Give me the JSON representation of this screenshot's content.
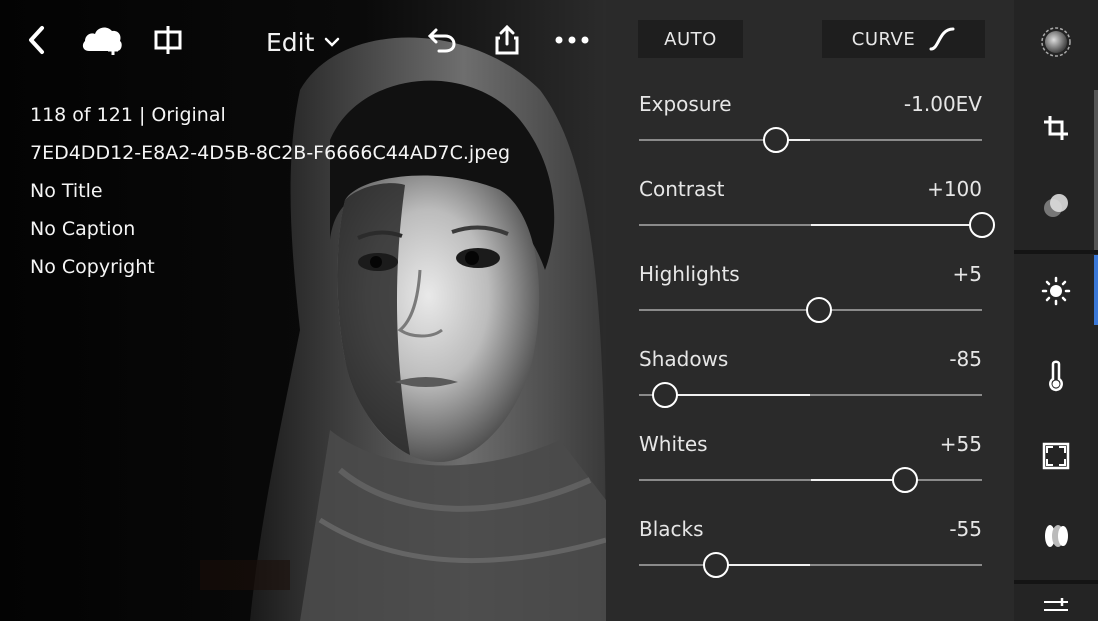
{
  "toolbar": {
    "back_icon": "chevron-left-icon",
    "cloud_icon": "cloud-add-icon",
    "compare_icon": "split-compare-icon",
    "edit_label": "Edit",
    "edit_chevron_icon": "chevron-down-icon",
    "undo_icon": "undo-icon",
    "share_icon": "share-icon",
    "more_icon": "more-dots-icon"
  },
  "info": {
    "count_line": "118 of 121 | Original",
    "filename": "7ED4DD12-E8A2-4D5B-8C2B-F6666C44AD7C.jpeg",
    "title": "No Title",
    "caption": "No Caption",
    "copyright": "No Copyright"
  },
  "panel": {
    "auto_label": "AUTO",
    "curve_label": "CURVE",
    "curve_icon": "curve-icon",
    "sliders": [
      {
        "label": "Exposure",
        "value_text": "-1.00EV",
        "value": -1.0,
        "min": -5,
        "max": 5
      },
      {
        "label": "Contrast",
        "value_text": "+100",
        "value": 100,
        "min": -100,
        "max": 100
      },
      {
        "label": "Highlights",
        "value_text": "+5",
        "value": 5,
        "min": -100,
        "max": 100
      },
      {
        "label": "Shadows",
        "value_text": "-85",
        "value": -85,
        "min": -100,
        "max": 100
      },
      {
        "label": "Whites",
        "value_text": "+55",
        "value": 55,
        "min": -100,
        "max": 100
      },
      {
        "label": "Blacks",
        "value_text": "-55",
        "value": -55,
        "min": -100,
        "max": 100
      }
    ]
  },
  "rail": {
    "items": [
      "presets-circle-icon",
      "crop-icon",
      "profile-icon",
      "light-icon",
      "color-temperature-icon",
      "effects-vignette-icon",
      "optics-icon",
      "adjust-sliders-icon"
    ],
    "active": "light-icon"
  },
  "colors": {
    "panel_bg": "#2a2a2a",
    "rail_bg": "#242424",
    "accent": "#3a78d8"
  }
}
